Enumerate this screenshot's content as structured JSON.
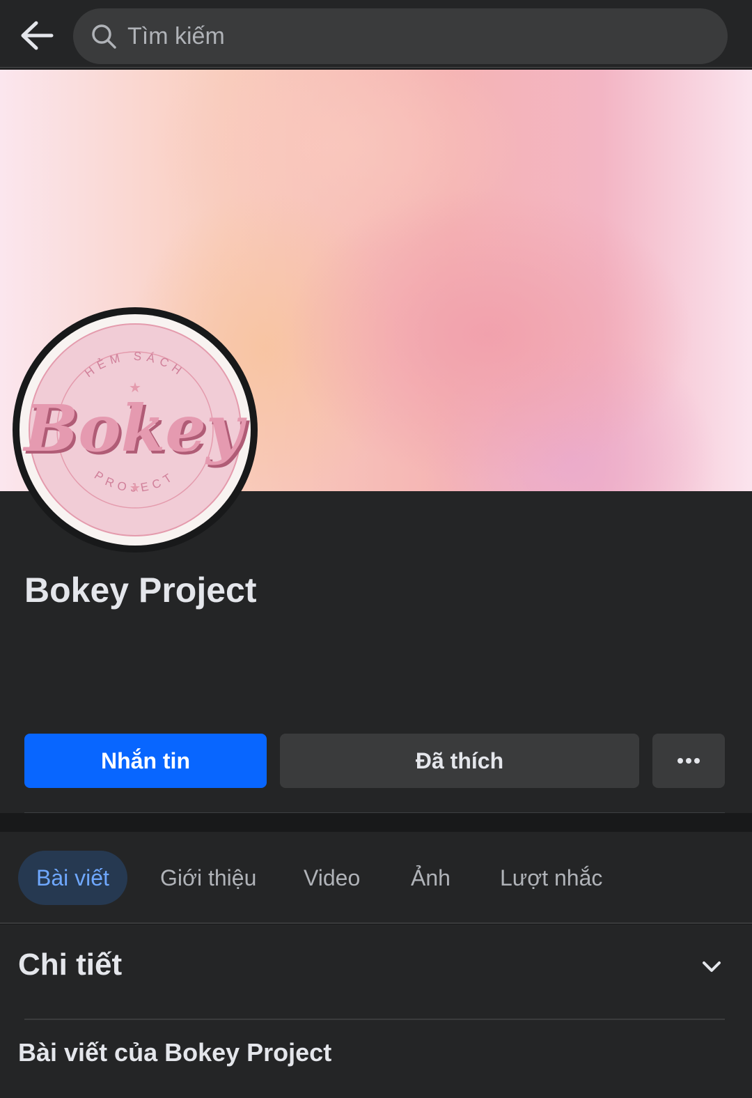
{
  "header": {
    "search_placeholder": "Tìm kiếm"
  },
  "profile": {
    "name": "Bokey Project",
    "avatar": {
      "logo_script": "Bokey",
      "logo_top_text": "HẺM SÁCH",
      "logo_bottom_text": "PROJECT"
    }
  },
  "actions": {
    "message_label": "Nhắn tin",
    "liked_label": "Đã thích",
    "more_icon": "more-horizontal-icon"
  },
  "tabs": [
    {
      "label": "Bài viết",
      "active": true
    },
    {
      "label": "Giới thiệu",
      "active": false
    },
    {
      "label": "Video",
      "active": false
    },
    {
      "label": "Ảnh",
      "active": false
    },
    {
      "label": "Lượt nhắc",
      "active": false
    }
  ],
  "details": {
    "title": "Chi tiết",
    "posts_heading": "Bài viết của Bokey Project"
  },
  "colors": {
    "primary": "#0866ff",
    "background": "#242526",
    "active_tab_bg": "#263951",
    "active_tab_text": "#6fa8ff",
    "logo_pink": "#e49bad"
  }
}
